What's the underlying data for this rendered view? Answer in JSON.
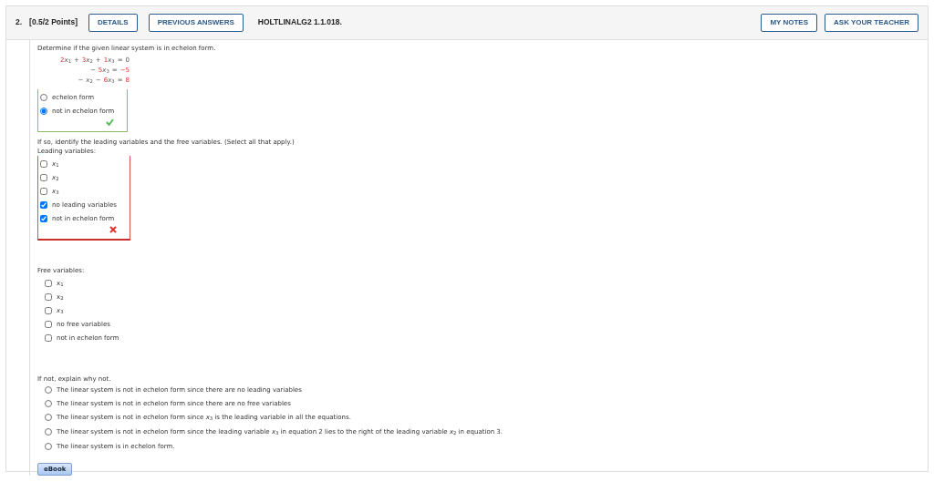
{
  "header": {
    "number": "2.",
    "points": "[0.5/2 Points]",
    "buttons": [
      "DETAILS",
      "PREVIOUS ANSWERS"
    ],
    "code": "HOLTLINALG2 1.1.018.",
    "right_buttons": [
      "MY NOTES",
      "ASK YOUR TEACHER"
    ]
  },
  "prompt": "Determine if the given linear system is in echelon form.",
  "equations": [
    {
      "tokens": [
        {
          "text": "2",
          "kind": "coef"
        },
        {
          "text": "*x*$_{1}$",
          "kind": "var"
        },
        {
          "text": "+",
          "kind": "op"
        },
        {
          "text": "3",
          "kind": "coef"
        },
        {
          "text": "*x*$_{2}$",
          "kind": "var"
        },
        {
          "text": "+",
          "kind": "op"
        },
        {
          "text": "1",
          "kind": "coef"
        },
        {
          "text": "*x*$_{3}$",
          "kind": "var"
        },
        {
          "text": "=",
          "kind": "op"
        },
        {
          "text": "0",
          "kind": "rhs"
        }
      ]
    },
    {
      "tokens": [
        {
          "text": "−",
          "kind": "op"
        },
        {
          "text": "5",
          "kind": "coef"
        },
        {
          "text": "*x*$_{3}$",
          "kind": "var"
        },
        {
          "text": "=",
          "kind": "op"
        },
        {
          "text": "−5",
          "kind": "coef"
        }
      ]
    },
    {
      "tokens": [
        {
          "text": "−",
          "kind": "op"
        },
        {
          "text": "*x*$_{2}$",
          "kind": "var"
        },
        {
          "text": "−",
          "kind": "op"
        },
        {
          "text": "6",
          "kind": "coef"
        },
        {
          "text": "*x*$_{3}$",
          "kind": "var"
        },
        {
          "text": "=",
          "kind": "op"
        },
        {
          "text": "8",
          "kind": "coef"
        }
      ]
    }
  ],
  "parts": [
    {
      "kind": "radio",
      "correct": true,
      "options": [
        {
          "label": "echelon form",
          "selected": false
        },
        {
          "label": "not in echelon form",
          "selected": true
        }
      ]
    },
    {
      "kind": "text",
      "text": "If so, identify the leading variables and the free variables. (Select all that apply.)"
    },
    {
      "kind": "text",
      "text": "Leading variables:"
    },
    {
      "kind": "checkbox",
      "correct": false,
      "options": [
        {
          "label": "*x*$_{1}$",
          "checked": false
        },
        {
          "label": "*x*$_{2}$",
          "checked": false
        },
        {
          "label": "*x*$_{3}$",
          "checked": false
        },
        {
          "label": "no leading variables",
          "checked": true
        },
        {
          "label": "not in echelon form",
          "checked": true
        }
      ]
    },
    {
      "kind": "gap"
    },
    {
      "kind": "text",
      "text": "Free variables:"
    },
    {
      "kind": "checkbox",
      "options": [
        {
          "label": "x$_{1}$",
          "checked": false
        },
        {
          "label": "x$_{2}$",
          "checked": false
        },
        {
          "label": "*x*$_{3}$",
          "checked": false
        },
        {
          "label": "no free variables",
          "checked": false
        },
        {
          "label": "not in echelon form",
          "checked": false
        }
      ]
    },
    {
      "kind": "gap"
    },
    {
      "kind": "text",
      "text": "If not, explain why not."
    },
    {
      "kind": "radio",
      "options": [
        {
          "label": "The linear system is not in echelon form since there are no leading variables",
          "selected": false
        },
        {
          "label": "The linear system is not in echelon form since there are no free variables",
          "selected": false
        },
        {
          "label": "The linear system is not in echelon form since *x*$_{3}$ is the leading variable in all the equations.",
          "selected": false
        },
        {
          "label": "The linear system is not in echelon form since the leading variable *x*$_{3}$ in equation 2 lies to the right of the leading variable *x*$_{2}$ in equation 3.",
          "selected": false
        },
        {
          "label": "The linear system is in echelon form.",
          "selected": false
        }
      ]
    }
  ],
  "ebook": "eBook"
}
